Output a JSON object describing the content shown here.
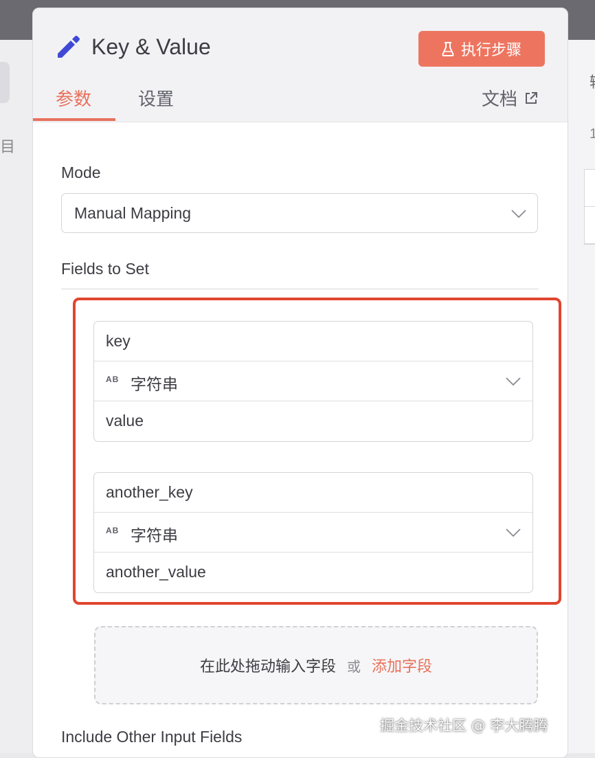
{
  "panel": {
    "title": "Key & Value",
    "execute_label": "执行步骤"
  },
  "tabs": {
    "params": "参数",
    "settings": "设置",
    "docs": "文档"
  },
  "mode": {
    "label": "Mode",
    "selected": "Manual Mapping"
  },
  "fields_to_set": {
    "label": "Fields to Set",
    "items": [
      {
        "name": "key",
        "type_abbr": "AB",
        "type": "字符串",
        "value": "value"
      },
      {
        "name": "another_key",
        "type_abbr": "AB",
        "type": "字符串",
        "value": "another_value"
      }
    ]
  },
  "dropzone": {
    "text": "在此处拖动输入字段",
    "or": "或",
    "add": "添加字段"
  },
  "include_other": {
    "label": "Include Other Input Fields"
  },
  "watermark": "掘金技术社区 @ 李大腾腾",
  "colors": {
    "accent": "#e8715b",
    "button": "#ed7560",
    "highlight_frame": "#e0452e",
    "pencil": "#3f49d6"
  }
}
